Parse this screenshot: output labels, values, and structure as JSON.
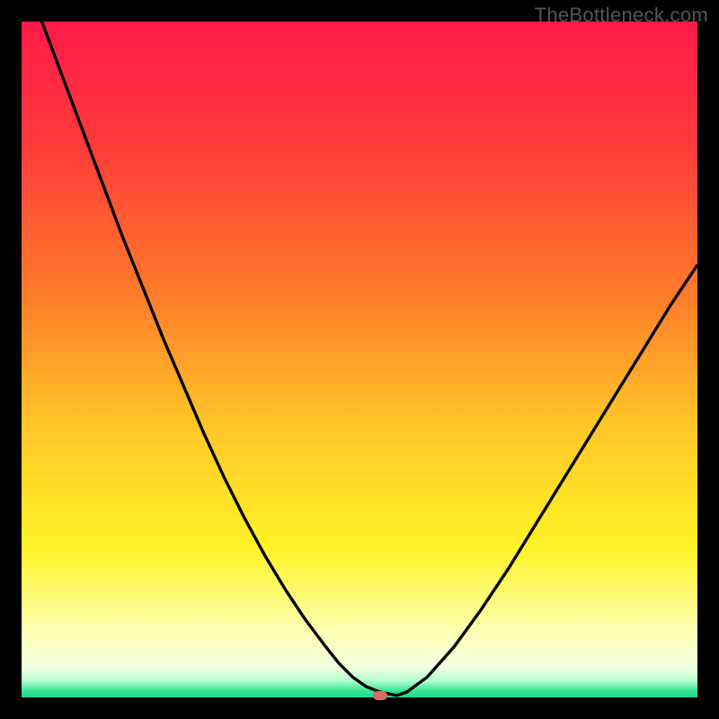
{
  "watermark": "TheBottleneck.com",
  "colors": {
    "frame": "#000000",
    "gradient_stops": [
      {
        "offset": 0.0,
        "color": "#ff1a49"
      },
      {
        "offset": 0.18,
        "color": "#ff3a3a"
      },
      {
        "offset": 0.4,
        "color": "#ff7a2a"
      },
      {
        "offset": 0.6,
        "color": "#ffc727"
      },
      {
        "offset": 0.78,
        "color": "#fff326"
      },
      {
        "offset": 0.9,
        "color": "#fdffb0"
      },
      {
        "offset": 0.955,
        "color": "#f3ffe0"
      },
      {
        "offset": 0.975,
        "color": "#b6ffcf"
      },
      {
        "offset": 0.99,
        "color": "#36e596"
      },
      {
        "offset": 1.0,
        "color": "#1fd989"
      }
    ],
    "curve": "#000000",
    "marker": "#d76a61"
  },
  "chart_data": {
    "type": "line",
    "title": "",
    "xlabel": "",
    "ylabel": "",
    "xlim": [
      0,
      100
    ],
    "ylim": [
      0,
      100
    ],
    "grid": false,
    "legend": false,
    "series": [
      {
        "name": "bottleneck-curve",
        "x": [
          0,
          3,
          6,
          9,
          12,
          15,
          18,
          21,
          24,
          27,
          30,
          33,
          36,
          39,
          42,
          45,
          47,
          49,
          51,
          53,
          55.5,
          57,
          60,
          64,
          68,
          72,
          76,
          80,
          84,
          88,
          92,
          96,
          100
        ],
        "y": [
          108,
          100,
          92,
          84,
          76,
          68,
          60.5,
          53,
          46,
          39,
          32.5,
          26.5,
          21,
          16,
          11.5,
          7.5,
          5,
          3,
          1.6,
          0.8,
          0.3,
          0.8,
          3,
          7.5,
          13,
          19,
          25.5,
          32,
          38.5,
          45,
          51.5,
          58,
          64
        ]
      }
    ],
    "flat_segment": {
      "x0": 49,
      "x1": 53,
      "y": 0.3
    },
    "marker": {
      "x": 53,
      "y": 0.3
    }
  }
}
